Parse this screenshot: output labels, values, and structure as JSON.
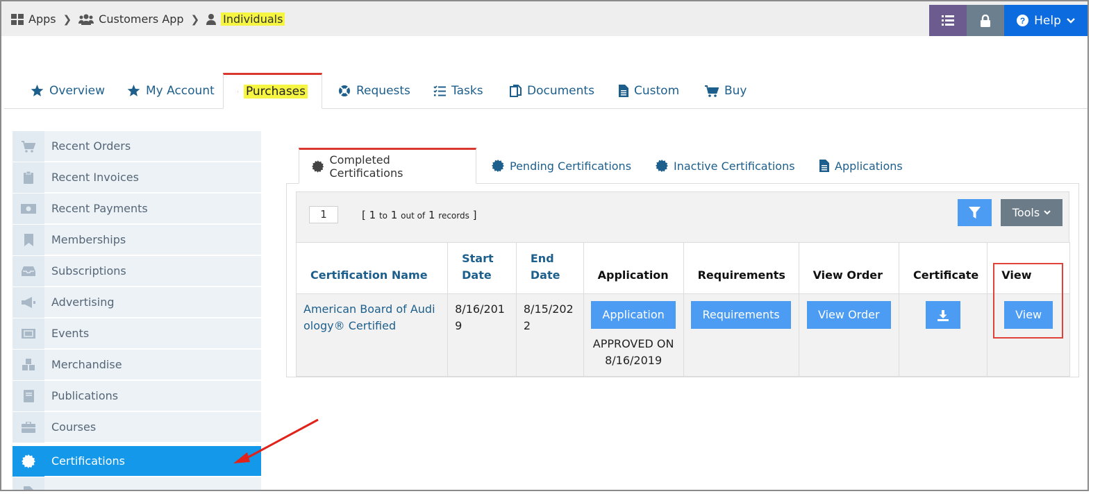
{
  "breadcrumb": {
    "items": [
      {
        "label": "Apps",
        "icon": "grid-icon"
      },
      {
        "label": "Customers App",
        "icon": "users-icon"
      },
      {
        "label": "Individuals",
        "icon": "user-icon"
      }
    ]
  },
  "top_buttons": {
    "list_icon": "list-icon",
    "lock_icon": "lock-icon",
    "help_label": "Help"
  },
  "main_tabs": [
    {
      "label": "Overview",
      "icon": "star-icon"
    },
    {
      "label": "My Account",
      "icon": "star-icon"
    },
    {
      "label": "Purchases",
      "icon": "cart-icon",
      "active": true
    },
    {
      "label": "Requests",
      "icon": "lifebuoy-icon"
    },
    {
      "label": "Tasks",
      "icon": "tasks-icon"
    },
    {
      "label": "Documents",
      "icon": "documents-icon"
    },
    {
      "label": "Custom",
      "icon": "document-icon"
    },
    {
      "label": "Buy",
      "icon": "cart-icon"
    }
  ],
  "sidebar": {
    "items": [
      {
        "label": "Recent Orders",
        "icon": "cart-icon"
      },
      {
        "label": "Recent Invoices",
        "icon": "clipboard-icon"
      },
      {
        "label": "Recent Payments",
        "icon": "money-icon"
      },
      {
        "label": "Memberships",
        "icon": "bookmark-icon"
      },
      {
        "label": "Subscriptions",
        "icon": "inbox-icon"
      },
      {
        "label": "Advertising",
        "icon": "megaphone-icon"
      },
      {
        "label": "Events",
        "icon": "ticket-icon"
      },
      {
        "label": "Merchandise",
        "icon": "cubes-icon"
      },
      {
        "label": "Publications",
        "icon": "book-icon"
      },
      {
        "label": "Courses",
        "icon": "briefcase-icon"
      },
      {
        "label": "Certifications",
        "icon": "certificate-icon",
        "active": true
      }
    ]
  },
  "sub_tabs": [
    {
      "label": "Completed Certifications",
      "icon": "certificate-icon",
      "active": true
    },
    {
      "label": "Pending Certifications",
      "icon": "certificate-icon"
    },
    {
      "label": "Inactive Certifications",
      "icon": "certificate-icon"
    },
    {
      "label": "Applications",
      "icon": "document-icon"
    }
  ],
  "toolbar": {
    "page": "1",
    "records_open": "[",
    "records_from": "1",
    "records_to_word": "to",
    "records_to": "1",
    "records_outof_word": "out of",
    "records_total": "1",
    "records_word": "records",
    "records_close": "]",
    "tools_label": "Tools"
  },
  "table": {
    "headers": [
      "Certification Name",
      "Start Date",
      "End Date",
      "Application",
      "Requirements",
      "View Order",
      "Certificate",
      "View"
    ],
    "rows": [
      {
        "certification_name": "American Board of Audiology® Certified",
        "start_date": "8/16/2019",
        "end_date": "8/15/2022",
        "application_button": "Application",
        "application_status": "APPROVED ON 8/16/2019",
        "requirements_button": "Requirements",
        "view_order_button": "View Order",
        "certificate_icon": "download-icon",
        "view_button": "View"
      }
    ]
  },
  "colors": {
    "accent": "#4d9cf3",
    "sidebar_active": "#1498ea",
    "tab_active_border": "#d9382f",
    "highlight": "#f5f542",
    "annotation_red": "#e0423a"
  }
}
